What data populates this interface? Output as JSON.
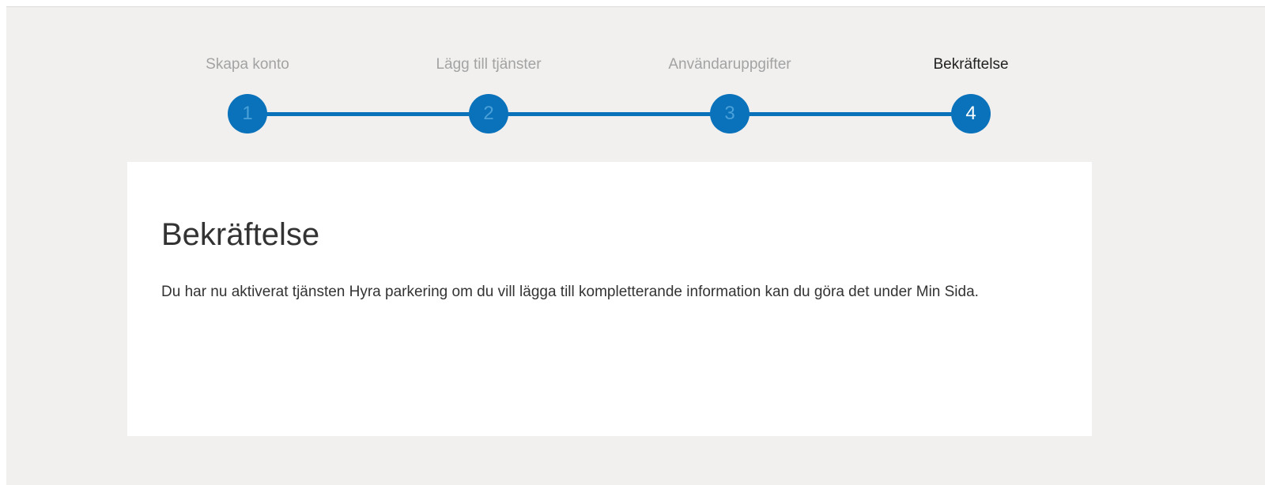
{
  "colors": {
    "accent": "#0a72bb",
    "page_background": "#f1f0ef",
    "card_background": "#ffffff",
    "inactive_label": "#a3a3a3",
    "active_label": "#222222"
  },
  "stepper": {
    "current_step": 4,
    "steps": [
      {
        "number": "1",
        "label": "Skapa konto"
      },
      {
        "number": "2",
        "label": "Lägg till tjänster"
      },
      {
        "number": "3",
        "label": "Användaruppgifter"
      },
      {
        "number": "4",
        "label": "Bekräftelse"
      }
    ]
  },
  "confirmation": {
    "title": "Bekräftelse",
    "message": "Du har nu aktiverat tjänsten Hyra parkering om du vill lägga till kompletterande information kan du göra det under Min Sida."
  }
}
